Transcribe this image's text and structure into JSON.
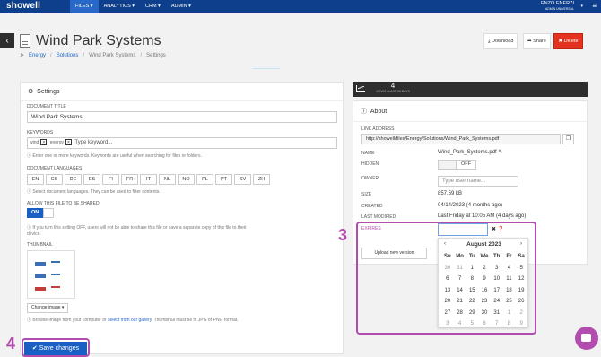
{
  "topbar": {
    "logo": "showell",
    "nav": [
      "FILES ▾",
      "ANALYTICS ▾",
      "CRM ▾",
      "ADMIN ▾"
    ],
    "user_name": "ENZO ENERZI",
    "user_role": "ADMIN UNIVERSAL"
  },
  "header": {
    "title": "Wind Park Systems",
    "breadcrumb": [
      "Energy",
      "Solutions",
      "Wind Park Systems",
      "Settings"
    ],
    "download_label": "Download",
    "share_label": "Share",
    "delete_label": "Delete"
  },
  "settings": {
    "heading": "Settings",
    "doc_title_label": "DOCUMENT TITLE",
    "doc_title_value": "Wind Park Systems",
    "keywords_label": "KEYWORDS",
    "keywords": [
      "wind",
      "energy"
    ],
    "keyword_placeholder": "Type keyword...",
    "keywords_hint": "Enter one or more keywords. Keywords are useful when searching for files or folders.",
    "languages_label": "DOCUMENT LANGUAGES",
    "languages": [
      "EN",
      "CS",
      "DE",
      "ES",
      "FI",
      "FR",
      "IT",
      "NL",
      "NO",
      "PL",
      "PT",
      "SV",
      "ZH"
    ],
    "languages_hint": "Select document languages. They can be used to filter contents.",
    "share_label": "ALLOW THIS FILE TO BE SHARED",
    "share_toggle": "ON",
    "share_hint": "If you turn this setting OFF, users will not be able to share this file or save a separate copy of this file to their device.",
    "thumbnail_label": "THUMBNAIL",
    "change_image_label": "Change image ▾",
    "thumb_hint_before": "Browse image from your computer or",
    "thumb_hint_link": "select from our gallery",
    "thumb_hint_after": ". Thumbnail must be in JPG or PNG format.",
    "save_label": "Save changes"
  },
  "stats": {
    "count": "4",
    "caption": "VIEWS / LAST 30 DAYS"
  },
  "about": {
    "heading": "About",
    "link_label": "LINK ADDRESS",
    "link_value": "http://showell/files/Energy/Solutions/Wind_Park_Systems.pdf",
    "name_label": "NAME",
    "name_value": "Wind_Park_Systems.pdf",
    "hidden_label": "HIDDEN",
    "hidden_toggle": "OFF",
    "owner_label": "OWNER",
    "owner_placeholder": "Type user name...",
    "size_label": "SIZE",
    "size_value": "857.59 kB",
    "created_label": "CREATED",
    "created_value": "04/14/2023 (4 months ago)",
    "modified_label": "LAST MODIFIED",
    "modified_value": "Last Friday at 10:05 AM (4 days ago)",
    "expires_label": "EXPIRES",
    "upload_label": "Upload new version"
  },
  "calendar": {
    "month": "August 2023",
    "day_names": [
      "Su",
      "Mo",
      "Tu",
      "We",
      "Th",
      "Fr",
      "Sa"
    ],
    "weeks": [
      [
        "30",
        "31",
        "1",
        "2",
        "3",
        "4",
        "5"
      ],
      [
        "6",
        "7",
        "8",
        "9",
        "10",
        "11",
        "12"
      ],
      [
        "13",
        "14",
        "15",
        "16",
        "17",
        "18",
        "19"
      ],
      [
        "20",
        "21",
        "22",
        "23",
        "24",
        "25",
        "26"
      ],
      [
        "27",
        "28",
        "29",
        "30",
        "31",
        "1",
        "2"
      ],
      [
        "3",
        "4",
        "5",
        "6",
        "7",
        "8",
        "9"
      ]
    ]
  },
  "callouts": {
    "step3": "3",
    "step4": "4"
  }
}
